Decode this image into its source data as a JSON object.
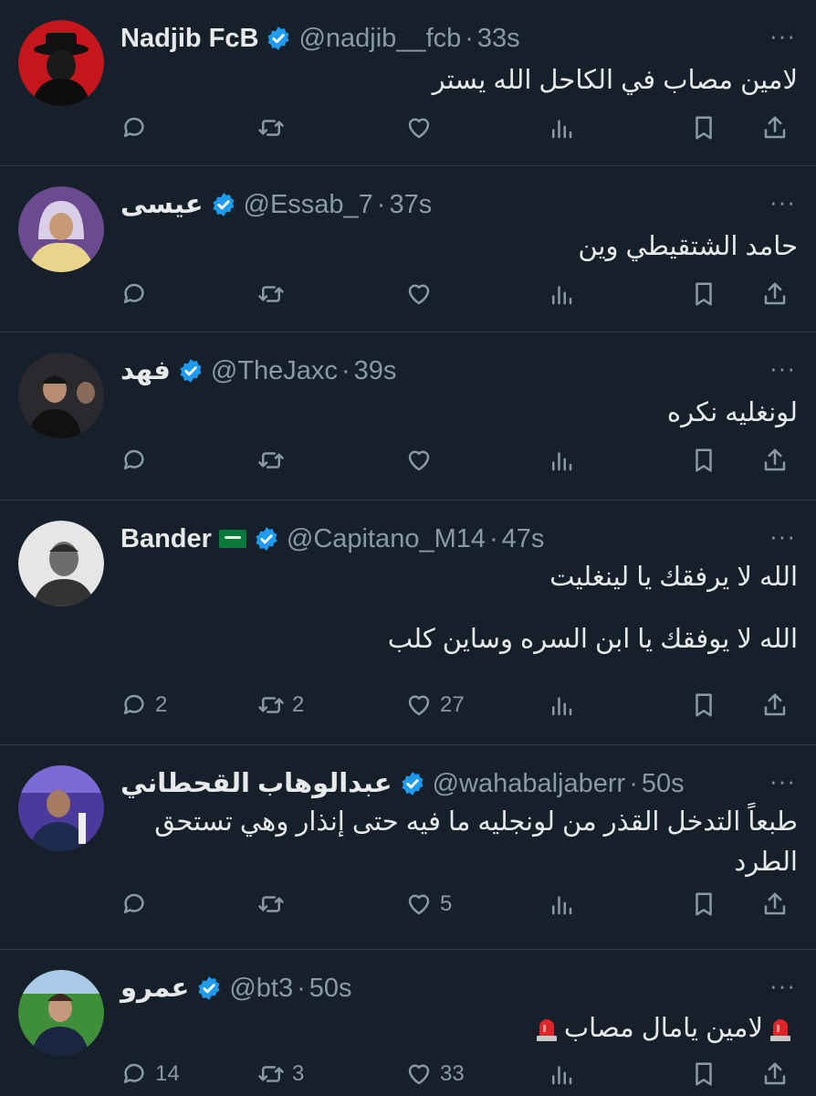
{
  "tweets": [
    {
      "name": "Nadjib FcB",
      "handle": "@nadjib__fcb",
      "dot": "·",
      "time": "33s",
      "lines": [
        "لامين مصاب في الكاحل الله يستر"
      ],
      "replies": "",
      "retweets": "",
      "likes": "",
      "avatar": "dark-hat-avatar"
    },
    {
      "name": "عيسى",
      "handle": "@Essab_7",
      "dot": "·",
      "time": "37s",
      "lines": [
        "حامد الشتقيطي وين"
      ],
      "replies": "",
      "retweets": "",
      "likes": "",
      "avatar": "purple-hood-avatar"
    },
    {
      "name": "فهد",
      "handle": "@TheJaxc",
      "dot": "·",
      "time": "39s",
      "lines": [
        "لونغليه نكره"
      ],
      "replies": "",
      "retweets": "",
      "likes": "",
      "avatar": "dark-group-avatar"
    },
    {
      "name": "Bander",
      "handle": "@Capitano_M14",
      "dot": "·",
      "time": "47s",
      "lines": [
        "الله لا يرفقك يا لينغليت",
        "الله لا يوفقك يا ابن السره وساين كلب"
      ],
      "replies": "2",
      "retweets": "2",
      "likes": "27",
      "flag": "saudi-flag",
      "avatar": "grayscale-player-avatar"
    },
    {
      "name": "عبدالوهاب القحطاني",
      "handle": "@wahabaljaberr",
      "dot": "·",
      "time": "50s",
      "lines": [
        "طبعاً التدخل القذر من لونجليه ما فيه حتى إنذار وهي تستحق الطرد"
      ],
      "replies": "",
      "retweets": "",
      "likes": "5",
      "avatar": "purple-stadium-avatar"
    },
    {
      "name": "عمرو",
      "handle": "@bt3",
      "dot": "·",
      "time": "50s",
      "lines": [
        "لامين يامال مصاب"
      ],
      "replies": "14",
      "retweets": "3",
      "likes": "33",
      "emoji": "police-light-emoji",
      "avatar": "green-pitch-avatar"
    }
  ],
  "icons": {
    "more": "···",
    "reply": "reply-icon",
    "retweet": "retweet-icon",
    "like": "heart-icon",
    "views": "views-icon",
    "bookmark": "bookmark-icon",
    "share": "share-icon"
  },
  "colors": {
    "background": "#15202b",
    "verified": "#1d9bf0",
    "muted": "#8b98a5",
    "text": "#e7e9ea"
  }
}
